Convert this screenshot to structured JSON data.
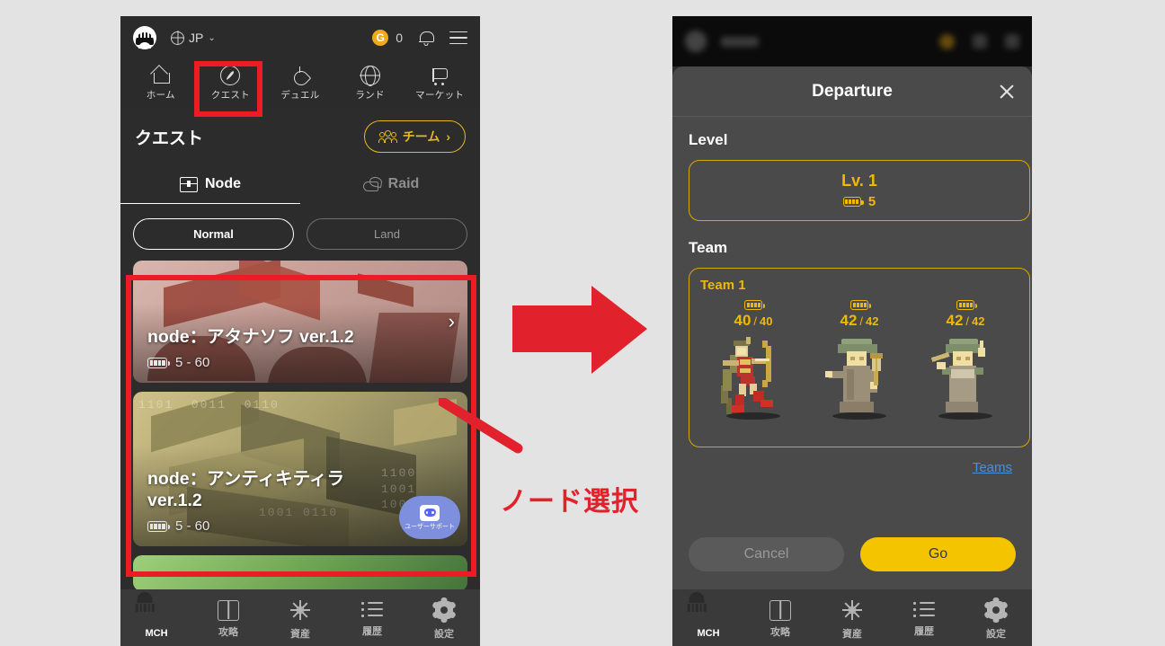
{
  "left_phone": {
    "topbar": {
      "logo_icon": "mch-logo-icon",
      "language": "JP",
      "caret": "⌄",
      "coin_badge": "G",
      "coin_amount": "0",
      "bell_icon": "bell-icon",
      "menu_icon": "hamburger-icon"
    },
    "nav": [
      {
        "icon": "home-icon",
        "label": "ホーム"
      },
      {
        "icon": "compass-icon",
        "label": "クエスト"
      },
      {
        "icon": "flame-icon",
        "label": "デュエル"
      },
      {
        "icon": "globe-icon",
        "label": "ランド"
      },
      {
        "icon": "cart-icon",
        "label": "マーケット"
      }
    ],
    "quest": {
      "title": "クエスト",
      "team_button": "チーム",
      "team_button_chevron": "›",
      "tabs": [
        {
          "label": "Node",
          "active": true
        },
        {
          "label": "Raid",
          "active": false
        }
      ],
      "filters": [
        {
          "label": "Normal",
          "selected": true
        },
        {
          "label": "Land",
          "selected": false
        }
      ]
    },
    "node_cards": [
      {
        "name": "node：アタナソフ ver.1.2",
        "level_range": "5 - 60",
        "chevron": "›"
      },
      {
        "name": "node：アンティキティラ ver.1.2",
        "level_range": "5 - 60",
        "chevron": ""
      }
    ],
    "support_fab": {
      "icon": "discord-icon",
      "label": "ユーザーサポート"
    },
    "bottom_nav": [
      {
        "icon": "mch-logo-icon",
        "label": "MCH",
        "active": true
      },
      {
        "icon": "map-icon",
        "label": "攻略",
        "active": false
      },
      {
        "icon": "sun-icon",
        "label": "資産",
        "active": false
      },
      {
        "icon": "list-icon",
        "label": "履歴",
        "active": false
      },
      {
        "icon": "gear-icon",
        "label": "設定",
        "active": false
      }
    ]
  },
  "right_phone": {
    "modal": {
      "title": "Departure",
      "close_icon": "close-icon",
      "level_section_label": "Level",
      "level_cards": [
        {
          "level": "Lv. 1",
          "stamina": "5",
          "selected": true
        }
      ],
      "team_section_label": "Team",
      "team_cards": [
        {
          "name": "Team 1",
          "selected": true,
          "units": [
            {
              "hp_current": "40",
              "hp_max": "40",
              "sprite": "archer-sprite"
            },
            {
              "hp_current": "42",
              "hp_max": "42",
              "sprite": "monk-sprite"
            },
            {
              "hp_current": "42",
              "hp_max": "42",
              "sprite": "mage-sprite"
            }
          ]
        }
      ],
      "teams_link": "Teams",
      "cancel_label": "Cancel",
      "go_label": "Go"
    },
    "bottom_nav": [
      {
        "icon": "mch-logo-icon",
        "label": "MCH",
        "active": true
      },
      {
        "icon": "map-icon",
        "label": "攻略",
        "active": false
      },
      {
        "icon": "sun-icon",
        "label": "資産",
        "active": false
      },
      {
        "icon": "list-icon",
        "label": "履歴",
        "active": false
      },
      {
        "icon": "gear-icon",
        "label": "設定",
        "active": false
      }
    ]
  },
  "annotations": {
    "step_text": "ノード選択",
    "arrow_icon": "right-arrow-annotation",
    "highlight_color": "#ed1c24"
  },
  "colors": {
    "accent_yellow": "#f0b900",
    "go_button": "#f5c400",
    "annotation_red": "#ed1c24",
    "link_blue": "#4a90d9",
    "modal_bg": "#4a4a4a",
    "app_bg": "#2c2c2c",
    "page_bg": "#e3e3e3"
  }
}
